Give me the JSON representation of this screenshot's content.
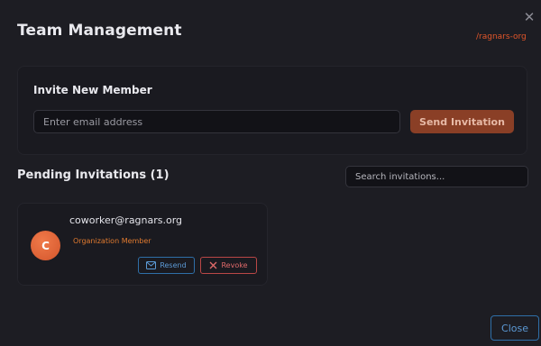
{
  "modal": {
    "title": "Team Management",
    "org_link": "/ragnars-org",
    "close_icon": "close-icon"
  },
  "invite": {
    "title": "Invite New Member",
    "email_placeholder": "Enter email address",
    "send_label": "Send Invitation"
  },
  "pending": {
    "title": "Pending Invitations (1)",
    "search_placeholder": "Search invitations...",
    "items": [
      {
        "avatar_letter": "C",
        "email": "coworker@ragnars.org",
        "role": "Organization Member",
        "resend_label": "Resend",
        "resend_icon": "mail-icon",
        "revoke_label": "Revoke",
        "revoke_icon": "x-icon"
      }
    ]
  },
  "footer": {
    "close_label": "Close"
  },
  "colors": {
    "background": "#1d1d23",
    "accent": "#e2562a",
    "send_button": "#8a3f26",
    "role": "#e07a2f",
    "resend": "#5c9ad6",
    "revoke": "#e06a6a"
  }
}
